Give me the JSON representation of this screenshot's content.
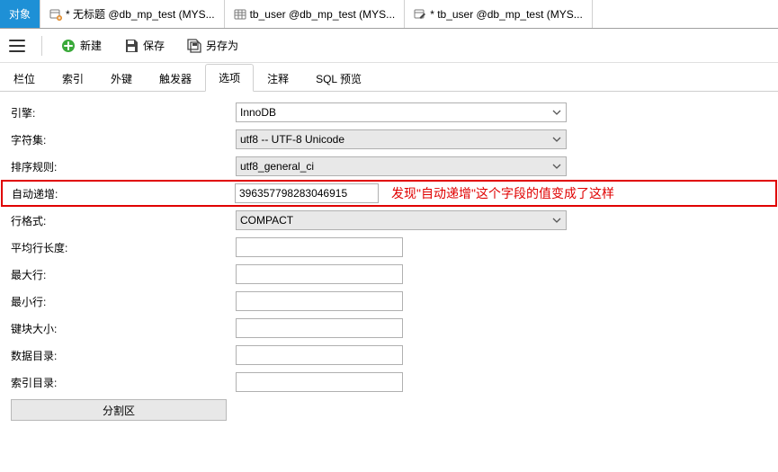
{
  "top_tabs": {
    "object": "对象",
    "tab1": "* 无标题 @db_mp_test (MYS...",
    "tab2": "tb_user @db_mp_test (MYS...",
    "tab3": "* tb_user @db_mp_test (MYS..."
  },
  "toolbar": {
    "new": "新建",
    "save": "保存",
    "saveas": "另存为"
  },
  "sub_tabs": {
    "columns": "栏位",
    "indexes": "索引",
    "fk": "外键",
    "triggers": "触发器",
    "options": "选项",
    "comment": "注释",
    "sql": "SQL 预览"
  },
  "form": {
    "engine_label": "引擎:",
    "engine_value": "InnoDB",
    "charset_label": "字符集:",
    "charset_value": "utf8 -- UTF-8 Unicode",
    "collation_label": "排序规则:",
    "collation_value": "utf8_general_ci",
    "autoinc_label": "自动递增:",
    "autoinc_value": "396357798283046915",
    "rowformat_label": "行格式:",
    "rowformat_value": "COMPACT",
    "avglen_label": "平均行长度:",
    "avglen_value": "",
    "maxrows_label": "最大行:",
    "maxrows_value": "",
    "minrows_label": "最小行:",
    "minrows_value": "",
    "keyblock_label": "键块大小:",
    "keyblock_value": "",
    "datadir_label": "数据目录:",
    "datadir_value": "",
    "indexdir_label": "索引目录:",
    "indexdir_value": ""
  },
  "annotation": "发现\"自动递增\"这个字段的值变成了这样",
  "bottom": {
    "partition": "分割区"
  }
}
